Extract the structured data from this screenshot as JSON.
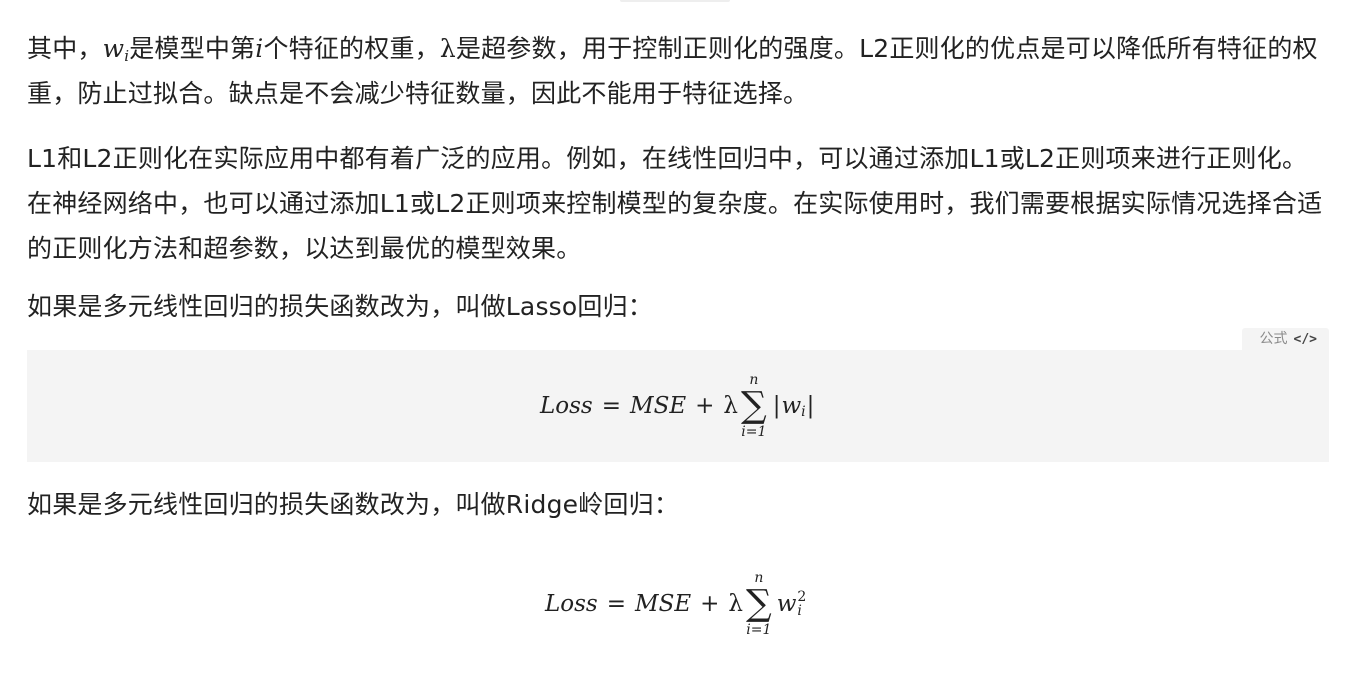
{
  "paragraphs": {
    "p1_before_w": "其中，",
    "p1_w_var": "w",
    "p1_w_sub": "i",
    "p1_mid1": "是模型中第",
    "p1_i_var": "i",
    "p1_mid2": "个特征的权重，",
    "p1_lambda": "λ",
    "p1_rest": "是超参数，用于控制正则化的强度。L2正则化的优点是可以降低所有特征的权重，防止过拟合。缺点是不会减少特征数量，因此不能用于特征选择。",
    "p2": "L1和L2正则化在实际应用中都有着广泛的应用。例如，在线性回归中，可以通过添加L1或L2正则项来进行正则化。在神经网络中，也可以通过添加L1或L2正则项来控制模型的复杂度。在实际使用时，我们需要根据实际情况选择合适的正则化方法和超参数，以达到最优的模型效果。",
    "p3": "如果是多元线性回归的损失函数改为，叫做Lasso回归：",
    "p4": "如果是多元线性回归的损失函数改为，叫做Ridge岭回归："
  },
  "formula_badge": {
    "label": "公式",
    "icon": "code-icon",
    "icon_glyph": "</>"
  },
  "formula_lasso": {
    "loss": "Loss",
    "eq": "=",
    "mse": "MSE",
    "plus": "+",
    "lambda": "λ",
    "sum_upper": "n",
    "sigma": "∑",
    "sum_lower": "i=1",
    "abs_left": "|",
    "w": "w",
    "w_sub": "i",
    "abs_right": "|"
  },
  "formula_ridge": {
    "loss": "Loss",
    "eq": "=",
    "mse": "MSE",
    "plus": "+",
    "lambda": "λ",
    "sum_upper": "n",
    "sigma": "∑",
    "sum_lower": "i=1",
    "w": "w",
    "w_sup": "2",
    "w_sub": "i"
  },
  "colors": {
    "text": "#222222",
    "formula_bg": "#f4f4f4",
    "badge_text": "#8a8a8a"
  }
}
